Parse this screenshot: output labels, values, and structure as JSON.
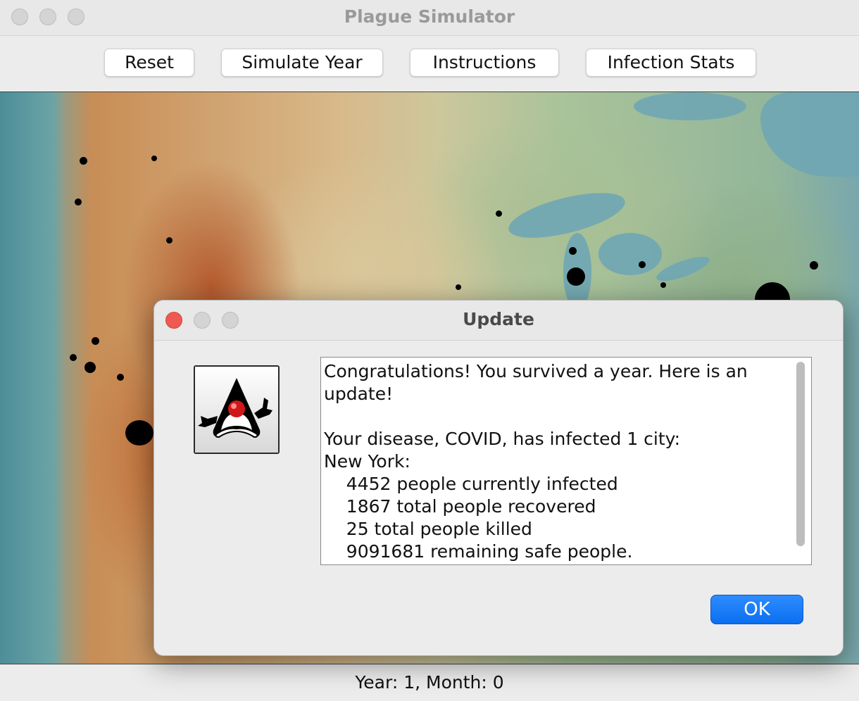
{
  "window": {
    "title": "Plague Simulator"
  },
  "toolbar": {
    "reset": "Reset",
    "simulate_year": "Simulate Year",
    "instructions": "Instructions",
    "infection_stats": "Infection Stats"
  },
  "status": {
    "text": "Year: 1, Month: 0"
  },
  "dialog": {
    "title": "Update",
    "message": "Congratulations! You survived a year. Here is an\nupdate!\n\nYour disease, COVID, has infected 1 city:\nNew York:\n    4452 people currently infected\n    1867 total people recovered\n    25 total people killed\n    9091681 remaining safe people.",
    "ok_label": "OK",
    "icon": "java-duke-icon"
  },
  "colors": {
    "ok_button": "#0a6ff0",
    "close_red": "#ee5a52"
  }
}
